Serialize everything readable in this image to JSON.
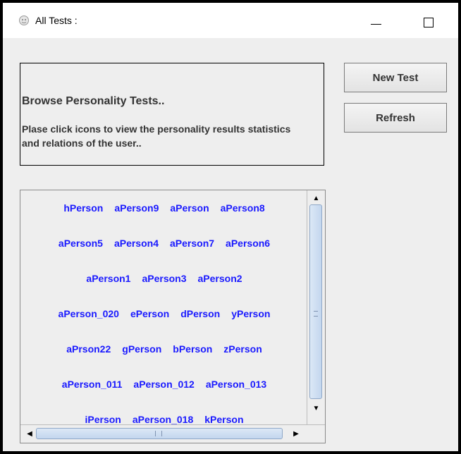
{
  "window": {
    "title": "All Tests :",
    "icon": "app-mask-icon"
  },
  "info": {
    "heading": "Browse Personality Tests..",
    "text": "Plase click icons to view the personality results statistics and relations of the user.."
  },
  "buttons": {
    "new_test": "New Test",
    "refresh": "Refresh"
  },
  "people_rows": [
    [
      "hPerson",
      "aPerson9",
      "aPerson",
      "aPerson8"
    ],
    [
      "aPerson5",
      "aPerson4",
      "aPerson7",
      "aPerson6"
    ],
    [
      "aPerson1",
      "aPerson3",
      "aPerson2"
    ],
    [
      "aPerson_020",
      "ePerson",
      "dPerson",
      "yPerson"
    ],
    [
      "aPrson22",
      "gPerson",
      "bPerson",
      "zPerson"
    ],
    [
      "aPerson_011",
      "aPerson_012",
      "aPerson_013"
    ],
    [
      "iPerson",
      "aPerson_018",
      "kPerson"
    ]
  ],
  "colors": {
    "link": "#1a1aff",
    "panel": "#eeeeee"
  }
}
